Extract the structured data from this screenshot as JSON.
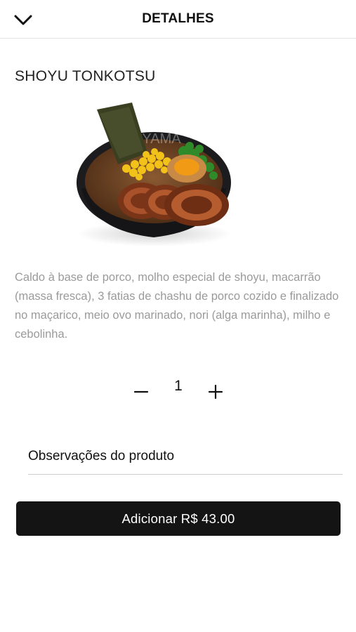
{
  "header": {
    "title": "DETALHES",
    "back_icon": "chevron-down-icon"
  },
  "product": {
    "name": "SHOYU TONKOTSU",
    "image_watermark": "YAMA",
    "description": "Caldo à base de porco, molho especial de shoyu, macarrão (massa fresca), 3 fatias de chashu de porco cozido e finalizado no maçarico, meio ovo marinado, nori (alga marinha), milho e cebolinha."
  },
  "quantity": {
    "value": "1",
    "decrement_icon": "minus-icon",
    "increment_icon": "plus-icon"
  },
  "notes": {
    "placeholder": "Observações do produto",
    "value": ""
  },
  "add_button": {
    "label": "Adicionar R$ 43.00"
  },
  "colors": {
    "button_bg": "#141414",
    "description_text": "#9a9a9a",
    "divider": "#e3e3e3"
  }
}
